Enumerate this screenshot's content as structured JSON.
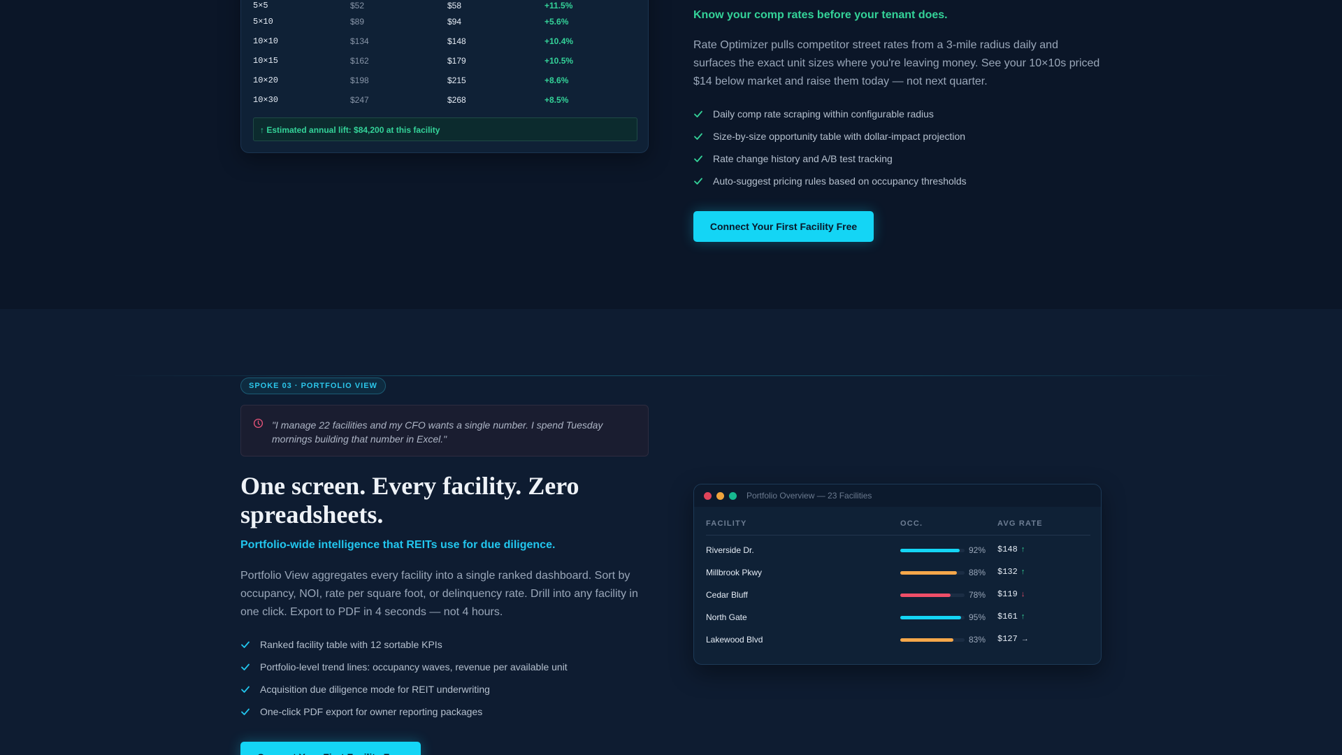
{
  "rate_table": {
    "rows": [
      {
        "size": "5×5",
        "current": "$52",
        "market": "$58",
        "gap": "+11.5%"
      },
      {
        "size": "5×10",
        "current": "$89",
        "market": "$94",
        "gap": "+5.6%"
      },
      {
        "size": "10×10",
        "current": "$134",
        "market": "$148",
        "gap": "+10.4%"
      },
      {
        "size": "10×15",
        "current": "$162",
        "market": "$179",
        "gap": "+10.5%"
      },
      {
        "size": "10×20",
        "current": "$198",
        "market": "$215",
        "gap": "+8.6%"
      },
      {
        "size": "10×30",
        "current": "$247",
        "market": "$268",
        "gap": "+8.5%"
      }
    ],
    "lift_text": "↑ Estimated annual lift: $84,200 at this facility"
  },
  "rate_optimizer": {
    "headline": "Know your comp rates before your tenant does.",
    "paragraph": "Rate Optimizer pulls competitor street rates from a 3-mile radius daily and surfaces the exact unit sizes where you're leaving money. See your 10×10s priced $14 below market and raise them today — not next quarter.",
    "features": [
      "Daily comp rate scraping within configurable radius",
      "Size-by-size opportunity table with dollar-impact projection",
      "Rate change history and A/B test tracking",
      "Auto-suggest pricing rules based on occupancy thresholds"
    ],
    "cta_label": "Connect Your First Facility Free"
  },
  "portfolio": {
    "badge": "SPOKE 03 · PORTFOLIO VIEW",
    "quote": "\"I manage 22 facilities and my CFO wants a single number. I spend Tuesday mornings building that number in Excel.\"",
    "title": "One screen. Every facility. Zero spreadsheets.",
    "subtitle": "Portfolio-wide intelligence that REITs use for due diligence.",
    "paragraph": "Portfolio View aggregates every facility into a single ranked dashboard. Sort by occupancy, NOI, rate per square foot, or delinquency rate. Drill into any facility in one click. Export to PDF in 4 seconds — not 4 hours.",
    "features": [
      "Ranked facility table with 12 sortable KPIs",
      "Portfolio-level trend lines: occupancy waves, revenue per available unit",
      "Acquisition due diligence mode for REIT underwriting",
      "One-click PDF export for owner reporting packages"
    ],
    "cta_label": "Connect Your First Facility Free"
  },
  "overview_window": {
    "title": "Portfolio Overview — 23 Facilities",
    "headers": {
      "facility": "FACILITY",
      "occ": "OCC.",
      "avg_rate": "AVG RATE"
    },
    "rows": [
      {
        "name": "Riverside Dr.",
        "occupancy": 92,
        "occ_label": "92%",
        "rate": "$148",
        "trend": "↑",
        "color": "#14d5f5"
      },
      {
        "name": "Millbrook Pkwy",
        "occupancy": 88,
        "occ_label": "88%",
        "rate": "$132",
        "trend": "↑",
        "color": "#f5a74a"
      },
      {
        "name": "Cedar Bluff",
        "occupancy": 78,
        "occ_label": "78%",
        "rate": "$119",
        "trend": "↓",
        "color": "#ef4f68"
      },
      {
        "name": "North Gate",
        "occupancy": 95,
        "occ_label": "95%",
        "rate": "$161",
        "trend": "↑",
        "color": "#14d5f5"
      },
      {
        "name": "Lakewood Blvd",
        "occupancy": 83,
        "occ_label": "83%",
        "rate": "$127",
        "trend": "→",
        "color": "#f5a74a"
      }
    ],
    "trend_colors": {
      "up": "#34d399",
      "down": "#ef4f68",
      "flat": "#c3ccd9"
    }
  },
  "icons": {
    "feature": "check-icon",
    "quote": "clock-icon"
  }
}
